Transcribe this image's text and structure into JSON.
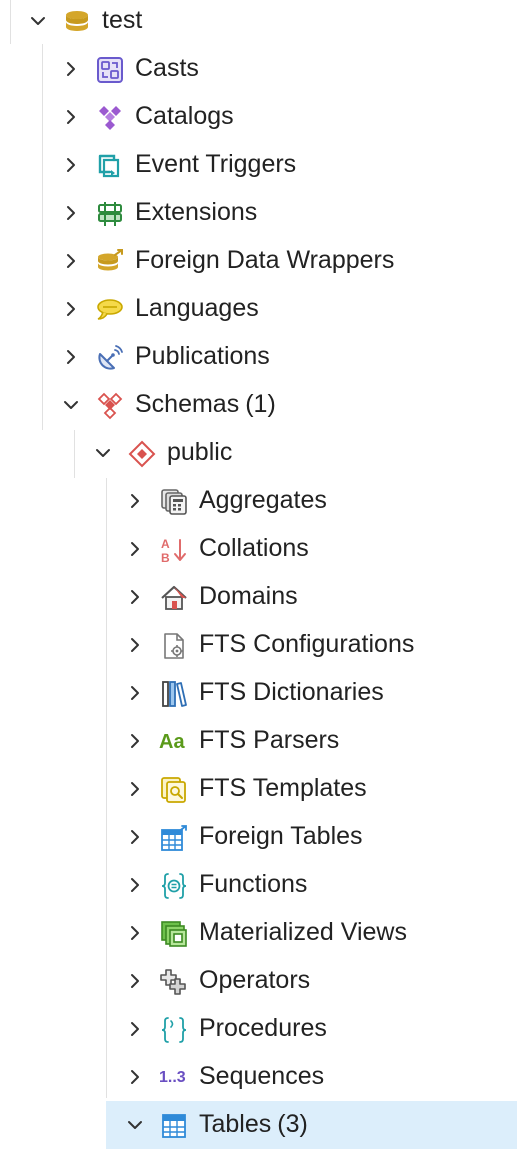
{
  "tree": {
    "root": {
      "label": "test",
      "expanded": true
    },
    "database_children": [
      {
        "label": "Casts",
        "icon": "casts-icon"
      },
      {
        "label": "Catalogs",
        "icon": "catalogs-icon"
      },
      {
        "label": "Event Triggers",
        "icon": "event-triggers-icon"
      },
      {
        "label": "Extensions",
        "icon": "extensions-icon"
      },
      {
        "label": "Foreign Data Wrappers",
        "icon": "foreign-data-wrappers-icon"
      },
      {
        "label": "Languages",
        "icon": "languages-icon"
      },
      {
        "label": "Publications",
        "icon": "publications-icon"
      }
    ],
    "schemas": {
      "label": "Schemas",
      "count": "(1)",
      "expanded": true
    },
    "public": {
      "label": "public",
      "expanded": true
    },
    "public_children": [
      {
        "label": "Aggregates",
        "icon": "aggregates-icon"
      },
      {
        "label": "Collations",
        "icon": "collations-icon"
      },
      {
        "label": "Domains",
        "icon": "domains-icon"
      },
      {
        "label": "FTS Configurations",
        "icon": "fts-configurations-icon"
      },
      {
        "label": "FTS Dictionaries",
        "icon": "fts-dictionaries-icon"
      },
      {
        "label": "FTS Parsers",
        "icon": "fts-parsers-icon",
        "glyph": "Aa"
      },
      {
        "label": "FTS Templates",
        "icon": "fts-templates-icon"
      },
      {
        "label": "Foreign Tables",
        "icon": "foreign-tables-icon"
      },
      {
        "label": "Functions",
        "icon": "functions-icon"
      },
      {
        "label": "Materialized Views",
        "icon": "materialized-views-icon"
      },
      {
        "label": "Operators",
        "icon": "operators-icon"
      },
      {
        "label": "Procedures",
        "icon": "procedures-icon"
      },
      {
        "label": "Sequences",
        "icon": "sequences-icon",
        "glyph": "1..3"
      }
    ],
    "tables": {
      "label": "Tables",
      "count": "(3)",
      "expanded": true,
      "selected": true
    }
  },
  "colors": {
    "selection": "#dceefb",
    "guide": "#e1e1e1",
    "text": "#222222"
  }
}
